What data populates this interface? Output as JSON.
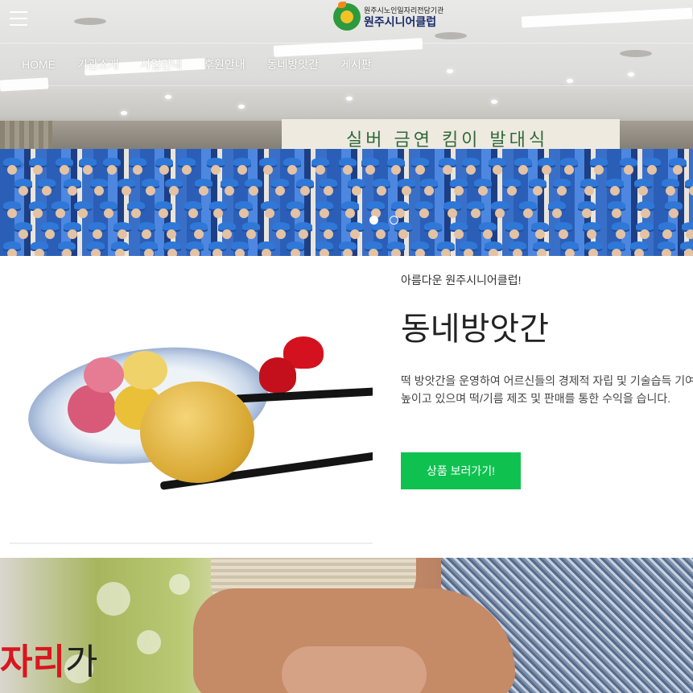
{
  "header": {
    "logo_sub": "원주시노인일자리전담기관",
    "logo_main": "원주시니어클럽",
    "menu_icon": "hamburger-menu-icon"
  },
  "nav": {
    "items": [
      "HOME",
      "기관소개",
      "사업안내",
      "후원안내",
      "동네방앗간",
      "게시판"
    ]
  },
  "hero": {
    "banner_text": "실버 금연 킴이 발대식",
    "slides": 2,
    "active_slide": 1
  },
  "feature": {
    "kicker": "아름다운 원주시니어클럽!",
    "title": "동네방앗간",
    "description": "떡 방앗간을 운영하여 어르신들의 경제적 자립 및 기술습득 기여를 높이고 있으며 떡/기름 제조 및 판매를 통한 수익을 습니다.",
    "button_label": "상품 보러가기!",
    "button_color": "#0fc250"
  },
  "bottom": {
    "tag_red": "자리",
    "tag_dark": "가"
  }
}
